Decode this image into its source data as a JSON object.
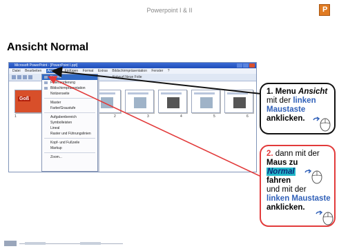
{
  "header": {
    "title": "Powerpoint I & II"
  },
  "heading": "Ansicht Normal",
  "screenshot": {
    "window_title": "Microsoft PowerPoint - [PowerPoint I.ppt]",
    "menu": [
      "Datei",
      "Bearbeiten",
      "Ansicht",
      "Einfügen",
      "Format",
      "Extras",
      "Bildschirmpräsentation",
      "Fenster",
      "?"
    ],
    "toolbar_text": "Entwurf   Neue Folie",
    "dropdown_items": [
      "Normal",
      "Foliensortierung",
      "Bildschirmpräsentation",
      "Notizenseite",
      "Master",
      "Farbe/Graustufe",
      "Aufgabenbereich",
      "Symbolleisten",
      "Lineal",
      "Raster und Führungslinien",
      "Kopf- und Fußzeile",
      "Markup",
      "Zoom..."
    ],
    "slide1_badge": "Goß",
    "slide_numbers": [
      "1",
      "2",
      "3",
      "4",
      "5",
      "6"
    ]
  },
  "callout1": {
    "num": "1.",
    "w1": "Menu",
    "w2": "Ansicht",
    "w3": "mit der",
    "w4": "linken",
    "w5": "Maustaste",
    "w6": "anklicken."
  },
  "callout2": {
    "num": "2.",
    "w1": "dann mit der",
    "w2": "Maus zu",
    "w3": "Normal",
    "w4": "fahren",
    "w5": "und mit der",
    "w6": "linken Maustaste",
    "w7": "anklicken."
  },
  "colors": {
    "accent_red": "#e23a3a",
    "accent_blue": "#3060b8",
    "highlight_teal": "#22b6c8"
  }
}
